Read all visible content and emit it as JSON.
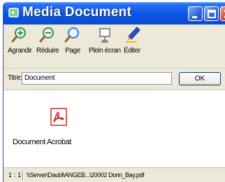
{
  "window": {
    "title": "Media Document"
  },
  "toolbar": {
    "items": [
      {
        "label": "Agrandir",
        "icon": "zoom-in-icon"
      },
      {
        "label": "Réduire",
        "icon": "zoom-out-icon"
      },
      {
        "label": "Page",
        "icon": "fit-page-icon"
      },
      {
        "label": "Plein écran",
        "icon": "fullscreen-icon"
      },
      {
        "label": "Éditer",
        "icon": "edit-pen-icon"
      }
    ]
  },
  "titre": {
    "label": "Titre:",
    "value": "Document",
    "ok_label": "OK"
  },
  "document": {
    "label": "Document Acrobat",
    "icon": "acrobat-pdf-icon"
  },
  "status": {
    "zoom": "1 : 1",
    "path": "\\\\Server\\Daubl\\ANGEB...\\20002 Dorin_Bay.pdf"
  },
  "colors": {
    "titlebar": "#0a55e6",
    "close_button": "#d9482a",
    "acrobat_red": "#d52b1e"
  }
}
